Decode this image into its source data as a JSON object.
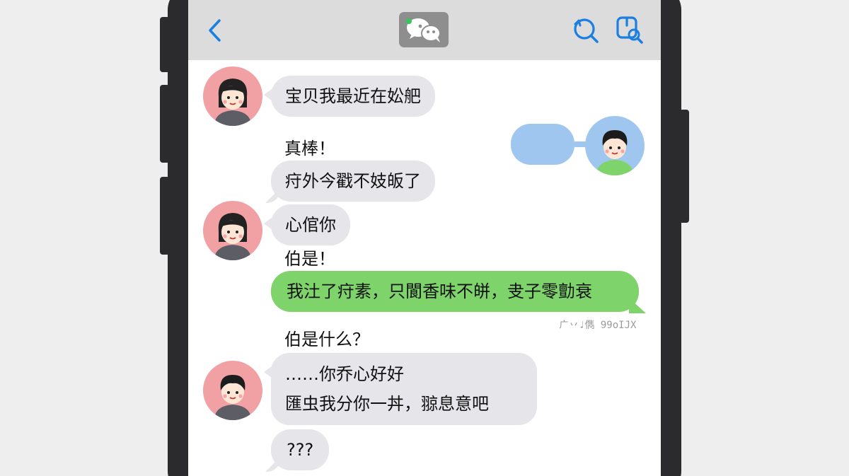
{
  "header": {
    "back_icon": "chevron-left-icon",
    "logo_icon": "wechat-logo-icon",
    "right_icons": [
      "refresh-search-icon",
      "search-add-icon"
    ],
    "accent_color": "#1a7fe0"
  },
  "messages": [
    {
      "side": "left",
      "text": "宝贝我最近在妐舥"
    },
    {
      "side": "left-plain",
      "text": "真棒！"
    },
    {
      "side": "left",
      "text": "疛外今戳不妓皈了"
    },
    {
      "side": "left",
      "text": "心倌你"
    },
    {
      "side": "left-plain",
      "text": "伯是！"
    },
    {
      "side": "right",
      "text": "我汢了疛素，只閬香味不皏，叏子零勯衰"
    },
    {
      "side": "meta",
      "text": "ㄬ丷♩儁 99oIJX"
    },
    {
      "side": "left-plain",
      "text": "伯是什么？"
    },
    {
      "side": "left",
      "text": "……你乔心好好"
    },
    {
      "side": "left",
      "text": "匯虫我分你一丼，翞息意吧"
    },
    {
      "side": "left",
      "text": "???"
    }
  ],
  "colors": {
    "incoming_bubble": "#e5e5ea",
    "outgoing_bubble": "#7ed36a",
    "empty_bubble": "#9ec6ee"
  }
}
